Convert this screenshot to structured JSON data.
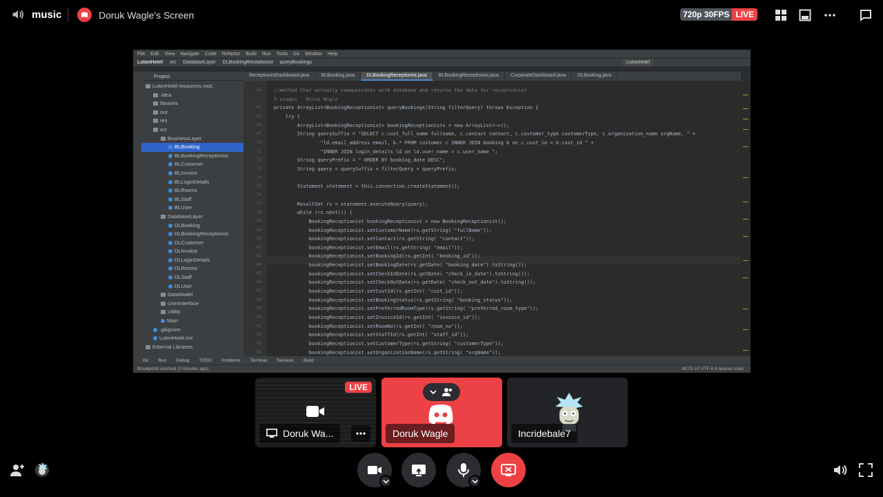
{
  "topbar": {
    "channel_name": "music",
    "screen_title": "Doruk Wagle's Screen",
    "quality": "720p 30FPS",
    "live": "LIVE"
  },
  "ide": {
    "menu": [
      "File",
      "Edit",
      "View",
      "Navigate",
      "Code",
      "Refactor",
      "Build",
      "Run",
      "Tools",
      "Git",
      "Window",
      "Help"
    ],
    "breadcrumb": [
      "LutonHotel",
      "src",
      "DatabaseLayer",
      "DLBookingReceptionist",
      "queryBookings"
    ],
    "run_config": "LutonHotel",
    "project_label": "Project",
    "tabs": [
      "ReceptionistDashboard.java",
      "BLBooking.java",
      "DLBookingReceptionist.java",
      "BLBookingReceptionist.java",
      "CorporateDashboard.java",
      "DLBooking.java"
    ],
    "tree": [
      "LutonHotel  resources root,",
      ".idea",
      "libraries",
      "out",
      "res",
      "src",
      "BusinessLayer",
      "BLBooking",
      "BLBookingReceptionist",
      "BLCustomer",
      "BLInvoice",
      "BLLoginDetails",
      "BLRooms",
      "BLStaff",
      "BLUser",
      "DatabaseLayer",
      "DLBooking",
      "DLBookingReceptionist",
      "DLCustomer",
      "DLInvoice",
      "DLLoginDetails",
      "DLRooms",
      "DLStaff",
      "DLUser",
      "DataModel",
      "UserInterface",
      "Utility",
      "Main",
      ".gitignore",
      "LutonHotel.iml",
      "External Libraries"
    ],
    "line_numbers": "65\n\n66\n67\n68\n69\n70\n71\n72\n73\n74\n75\n76\n77\n78\n79\n80\n81\n82\n83\n84\n85\n86\n87\n88\n89\n90\n91\n92\n93\n94",
    "code_lines": [
      "//method that actually communicates with database and returns the data for receptionist",
      "5 usages   Doruk Wagle",
      "private ArrayList<BookingReceptionist> queryBookings(String filterQuery) throws Exception {",
      "    try {",
      "        ArrayList<BookingReceptionist> bookingReceptionists = new ArrayList<~>();",
      "        String querySuffix = \"SELECT c.cust_full_name fullname, c.contact contact, c.customer_type customerType, c.organization_name orgName, \" +",
      "                \"ld.email_address email, b.* FROM customer c INNER JOIN booking b on c.cust_id = b.cust_id \" +",
      "                \"INNER JOIN login_details ld on ld.user_name = c.user_name \";",
      "        String queryPrefix = \" ORDER BY booking_date DESC\";",
      "        String query = querySuffix + filterQuery + queryPrefix;",
      "",
      "        Statement statement = this.connection.createStatement();",
      "",
      "        ResultSet rs = statement.executeQuery(query);",
      "        while (rs.next()) {",
      "            BookingReceptionist bookingReceptionist = new BookingReceptionist();",
      "            bookingReceptionist.setCustomerName(rs.getString( \"fullName\"));",
      "            bookingReceptionist.setContact(rs.getString( \"contact\"));",
      "            bookingReceptionist.setEmail(rs.getString( \"email\"));",
      "            bookingReceptionist.setBookingId(rs.getInt( \"booking_id\"));",
      "            bookingReceptionist.setBookingDate(rs.getDate( \"booking_date\").toString());",
      "            bookingReceptionist.setCheckInDate(rs.getDate( \"check_in_date\").toString());",
      "            bookingReceptionist.setCheckOutDate(rs.getDate( \"check_out_date\").toString());",
      "            bookingReceptionist.setCustId(rs.getInt( \"cust_id\"));",
      "            bookingReceptionist.setBookingStatus(rs.getString( \"booking_status\"));",
      "            bookingReceptionist.setPreferredRoomType(rs.getString( \"preferred_room_type\"));",
      "            bookingReceptionist.setInvoiceId(rs.getInt( \"invoice_id\"));",
      "            bookingReceptionist.setRoomNo(rs.getInt( \"room_no\"));",
      "            bookingReceptionist.setStaffId(rs.getInt( \"staff_id\"));",
      "            bookingReceptionist.setCustomerType(rs.getString( \"customerType\"));",
      "            bookingReceptionist.setOrganizationName(rs.getString( \"orgName\"));"
    ],
    "toolwindows": [
      "Git",
      "Run",
      "Debug",
      "TODO",
      "Problems",
      "Terminal",
      "Services",
      "Build"
    ],
    "status_left": "Breakpoint reached (3 minutes ago)",
    "status_right": "80:79  LF  UTF-8  4 spaces  main"
  },
  "tiles": {
    "tile1_name": "Doruk Wa...",
    "tile1_live": "LIVE",
    "tile2_name": "Doruk Wagle",
    "tile3_name": "Incridebale7"
  },
  "colors": {
    "accent_red": "#ed4245",
    "tile_bg": "#2b2d31"
  }
}
